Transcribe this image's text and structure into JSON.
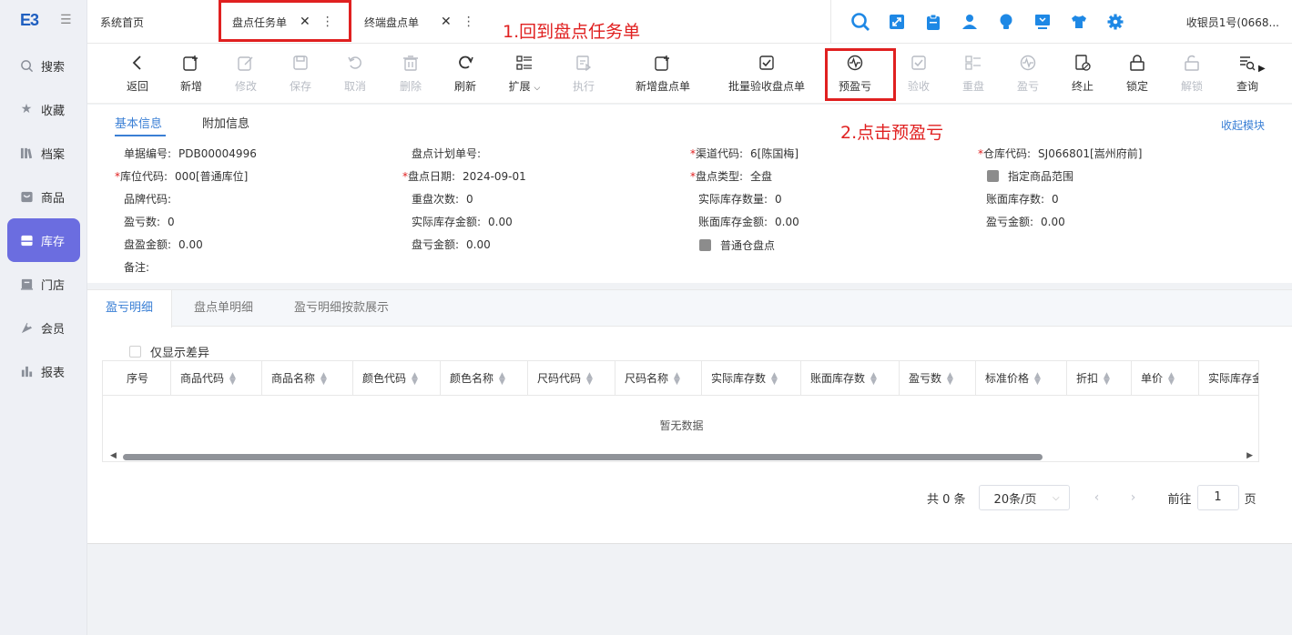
{
  "app": {
    "logo": "E3"
  },
  "sidebar": {
    "items": [
      {
        "label": "搜索",
        "icon": "search-icon",
        "active": false
      },
      {
        "label": "收藏",
        "icon": "star-icon",
        "active": false
      },
      {
        "label": "档案",
        "icon": "archive-icon",
        "active": false
      },
      {
        "label": "商品",
        "icon": "product-icon",
        "active": false
      },
      {
        "label": "库存",
        "icon": "inventory-icon",
        "active": true
      },
      {
        "label": "门店",
        "icon": "store-icon",
        "active": false
      },
      {
        "label": "会员",
        "icon": "member-icon",
        "active": false
      },
      {
        "label": "报表",
        "icon": "report-icon",
        "active": false
      }
    ]
  },
  "tabs": [
    {
      "label": "系统首页"
    },
    {
      "label": "盘点任务单",
      "active": true
    },
    {
      "label": "终端盘点单"
    }
  ],
  "annotations": {
    "step1": "1.回到盘点任务单",
    "step2": "2.点击预盈亏"
  },
  "header": {
    "user": "收银员1号(0668...",
    "tool_icons": [
      "search-icon",
      "expand-icon",
      "clipboard-icon",
      "user-icon",
      "bulb-icon",
      "monitor-icon",
      "shirt-icon",
      "gear-icon"
    ],
    "accent": "#1e88e5"
  },
  "toolbar": {
    "back": "返回",
    "new": "新增",
    "edit": "修改",
    "save": "保存",
    "cancel": "取消",
    "delete": "删除",
    "refresh": "刷新",
    "extend": "扩展",
    "execute": "执行",
    "new_count": "新增盘点单",
    "batch_verify": "批量验收盘点单",
    "pre_profit": "预盈亏",
    "verify": "验收",
    "recount": "重盘",
    "profit": "盈亏",
    "terminate": "终止",
    "lock": "锁定",
    "unlock": "解锁",
    "query": "查询"
  },
  "info_tabs": {
    "basic": "基本信息",
    "extra": "附加信息",
    "collapse": "收起模块"
  },
  "fields": {
    "doc_no_label": "单据编号:",
    "doc_no": "PDB00004996",
    "plan_no_label": "盘点计划单号:",
    "plan_no": "",
    "channel_label": "渠道代码:",
    "channel": "6[陈国梅]",
    "warehouse_label": "仓库代码:",
    "warehouse": "SJ066801[嵩州府前]",
    "location_label": "库位代码:",
    "location": "000[普通库位]",
    "date_label": "盘点日期:",
    "date": "2024-09-01",
    "type_label": "盘点类型:",
    "type": "全盘",
    "scope_label": "指定商品范围",
    "brand_label": "品牌代码:",
    "brand": "",
    "recount_label": "重盘次数:",
    "recount": "0",
    "actual_qty_label": "实际库存数量:",
    "actual_qty": "0",
    "book_qty_label": "账面库存数:",
    "book_qty": "0",
    "pl_qty_label": "盈亏数:",
    "pl_qty": "0",
    "actual_amt_label": "实际库存金额:",
    "actual_amt": "0.00",
    "book_amt_label": "账面库存金额:",
    "book_amt": "0.00",
    "pl_amt_label": "盈亏金额:",
    "pl_amt": "0.00",
    "profit_amt_label": "盘盈金额:",
    "profit_amt": "0.00",
    "loss_amt_label": "盘亏金额:",
    "loss_amt": "0.00",
    "normal_wh_label": "普通仓盘点",
    "remark_label": "备注:",
    "remark": ""
  },
  "detail": {
    "tabs": [
      "盈亏明细",
      "盘点单明细",
      "盈亏明细按款展示"
    ],
    "only_diff": "仅显示差异",
    "columns": [
      "序号",
      "商品代码",
      "商品名称",
      "颜色代码",
      "颜色名称",
      "尺码代码",
      "尺码名称",
      "实际库存数",
      "账面库存数",
      "盈亏数",
      "标准价格",
      "折扣",
      "单价",
      "实际库存金"
    ],
    "empty": "暂无数据"
  },
  "pager": {
    "total": "共 0 条",
    "size": "20条/页",
    "goto": "前往",
    "page": "1",
    "page_unit": "页"
  }
}
